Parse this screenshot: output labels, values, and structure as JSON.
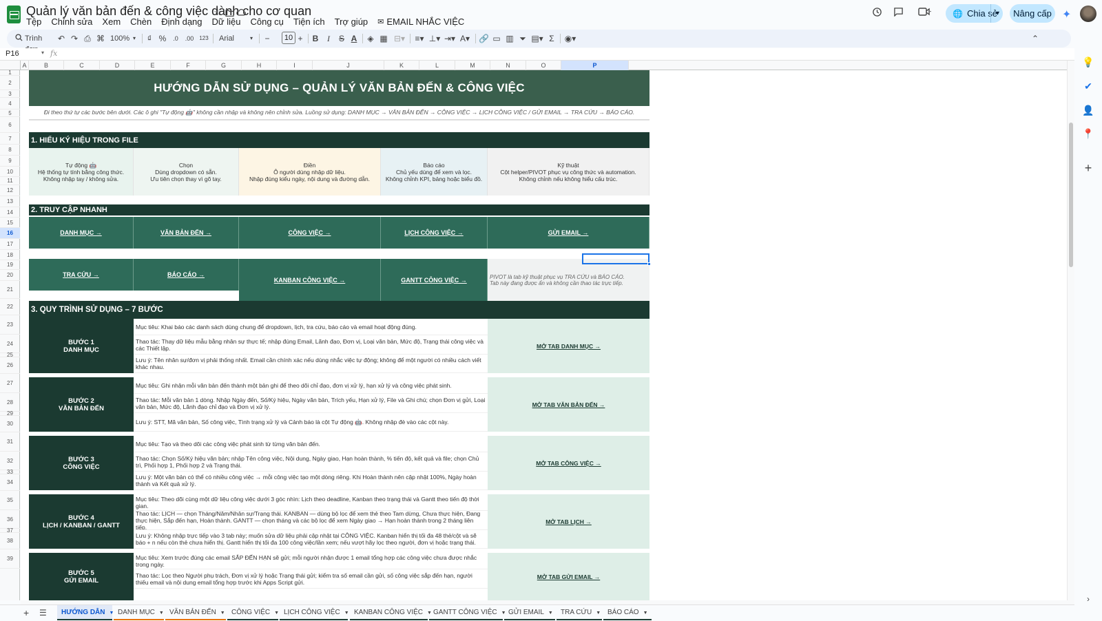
{
  "app": {
    "title": "Quản lý văn bản đến & công việc dành cho cơ quan",
    "menu": [
      "Tệp",
      "Chỉnh sửa",
      "Xem",
      "Chèn",
      "Định dạng",
      "Dữ liệu",
      "Công cụ",
      "Tiện ích",
      "Trợ giúp"
    ],
    "menu_email": "EMAIL NHẮC VIỆC",
    "share": "Chia sẻ",
    "upgrade": "Nâng cấp"
  },
  "toolbar": {
    "search": "Trình đơn",
    "zoom": "100%",
    "currency": "₫",
    "percent": "%",
    "dec_down": ".0",
    "dec_up": ".00",
    "num_fmt": "123",
    "font": "Arial",
    "font_size": "10"
  },
  "formula": {
    "cell": "P16",
    "fx": "fx"
  },
  "columns": [
    "A",
    "B",
    "C",
    "D",
    "E",
    "F",
    "G",
    "H",
    "I",
    "J",
    "K",
    "L",
    "M",
    "N",
    "O",
    "P"
  ],
  "rows": [
    "1",
    "2",
    "3",
    "4",
    "5",
    "6",
    "7",
    "8",
    "9",
    "10",
    "11",
    "12",
    "13",
    "14",
    "15",
    "16",
    "17",
    "18",
    "19",
    "20",
    "21",
    "22",
    "23",
    "24",
    "25",
    "26",
    "27",
    "28",
    "29",
    "30",
    "31",
    "32",
    "33",
    "34",
    "35",
    "36",
    "37",
    "38",
    "39"
  ],
  "sheet": {
    "banner": "HƯỚNG DẪN SỬ DỤNG – QUẢN LÝ VĂN BẢN ĐẾN & CÔNG VIỆC",
    "subline": "Đi theo thứ tự các bước bên dưới. Các ô ghi \"Tự động 🤖\" không cần nhập và không nên chỉnh sửa. Luồng sử dụng: DANH MỤC → VĂN BẢN ĐẾN → CÔNG VIỆC → LỊCH CÔNG VIỆC / GỬI EMAIL → TRA CỨU → BÁO CÁO.",
    "sec1": "1. HIỂU KÝ HIỆU TRONG FILE",
    "legend": [
      {
        "title": "Tự động 🤖",
        "l1": "Hệ thống tự tính bằng công thức.",
        "l2": "Không nhập tay / không sửa.",
        "bg": "#e8f3ee"
      },
      {
        "title": "Chọn",
        "l1": "Dùng dropdown có sẵn.",
        "l2": "Ưu tiên chọn thay vì gõ tay.",
        "bg": "#eef5f1"
      },
      {
        "title": "Điền",
        "l1": "Ô người dùng nhập dữ liệu.",
        "l2": "Nhập đúng kiểu ngày, nội dung và đường dẫn.",
        "bg": "#fdf5e4"
      },
      {
        "title": "Báo cáo",
        "l1": "Chủ yếu dùng để xem và lọc.",
        "l2": "Không chỉnh KPI, bảng hoặc biểu đồ.",
        "bg": "#e7f1f4"
      },
      {
        "title": "Kỹ thuật",
        "l1": "Cột helper/PIVOT phục vụ công thức và automation.",
        "l2": "Không chỉnh nếu không hiểu cấu trúc.",
        "bg": "#f1f1f1"
      }
    ],
    "sec2": "2. TRUY CẬP NHANH",
    "quick1": [
      "DANH MỤC →",
      "VĂN BẢN ĐẾN →",
      "CÔNG VIỆC →",
      "LỊCH CÔNG VIỆC →",
      "GỬI EMAIL →"
    ],
    "quick2": [
      "TRA CỨU →",
      "BÁO CÁO →",
      "KANBAN CÔNG VIỆC →",
      "GANTT CÔNG VIỆC →"
    ],
    "pivot_note1": "PIVOT là tab kỹ thuật phục vụ TRA CỨU và BÁO CÁO.",
    "pivot_note2": "Tab này đang được ẩn và không cần thao tác trực tiếp.",
    "sec3": "3. QUY TRÌNH SỬ DỤNG – 7 BƯỚC",
    "steps": [
      {
        "n": "BƯỚC 1",
        "name": "DANH MỤC",
        "goal": "Mục tiêu: Khai báo các danh sách dùng chung để dropdown, lịch, tra cứu, báo cáo và email hoạt động đúng.",
        "action": "Thao tác: Thay dữ liệu mẫu bằng nhân sự thực tế; nhập đúng Email, Lãnh đạo, Đơn vị, Loại văn bản, Mức độ, Trạng thái công việc và các Thiết lập.",
        "note": "Lưu ý: Tên nhân sự/đơn vị phải thống nhất. Email cần chính xác nếu dùng nhắc việc tự động; không để một người có nhiều cách viết khác nhau.",
        "link": "MỞ TAB DANH MỤC →"
      },
      {
        "n": "BƯỚC 2",
        "name": "VĂN BẢN ĐẾN",
        "goal": "Mục tiêu: Ghi nhận mỗi văn bản đến thành một bản ghi để theo dõi chỉ đạo, đơn vị xử lý, hạn xử lý và công việc phát sinh.",
        "action": "Thao tác: Mỗi văn bản 1 dòng. Nhập Ngày đến, Số/Ký hiệu, Ngày văn bản, Trích yếu, Hạn xử lý, File và Ghi chú; chọn Đơn vị gửi, Loại văn bản, Mức độ, Lãnh đạo chỉ đạo và Đơn vị xử lý.",
        "note": "Lưu ý: STT, Mã văn bản, Số công việc, Tình trạng xử lý và Cảnh báo là cột Tự động 🤖. Không nhập đè vào các cột này.",
        "link": "MỞ TAB VĂN BẢN ĐẾN →"
      },
      {
        "n": "BƯỚC 3",
        "name": "CÔNG VIỆC",
        "goal": "Mục tiêu: Tạo và theo dõi các công việc phát sinh từ từng văn bản đến.",
        "action": "Thao tác: Chọn Số/Ký hiệu văn bản; nhập Tên công việc, Nội dung, Ngày giao, Hạn hoàn thành, % tiến độ, kết quả và file; chọn Chủ trì, Phối hợp 1, Phối hợp 2 và Trạng thái.",
        "note": "Lưu ý: Một văn bản có thể có nhiều công việc → mỗi công việc tạo một dòng riêng. Khi Hoàn thành nên cập nhật 100%, Ngày hoàn thành và Kết quả xử lý.",
        "link": "MỞ TAB CÔNG VIỆC →"
      },
      {
        "n": "BƯỚC 4",
        "name": "LỊCH / KANBAN / GANTT",
        "goal": "Mục tiêu: Theo dõi cùng một dữ liệu công việc dưới 3 góc nhìn: Lịch theo deadline, Kanban theo trạng thái và Gantt theo tiến độ thời gian.",
        "action": "Thao tác: LỊCH — chọn Tháng/Năm/Nhân sự/Trạng thái. KANBAN — dùng bộ lọc để xem thẻ theo Tam dừng, Chưa thực hiện, Đang thực hiện, Sắp đến hạn, Hoàn thành. GANTT — chọn tháng và các bộ lọc để xem Ngày giao → Hạn hoàn thành trong 2 tháng liên tiếp.",
        "note": "Lưu ý: Không nhập trực tiếp vào 3 tab này; muốn sửa dữ liệu phải cập nhật tại CÔNG VIỆC. Kanban hiển thị tối đa 48 thẻ/cột và sẽ báo + n nếu còn thẻ chưa hiển thị. Gantt hiển thị tối đa 100 công việc/lần xem; nếu vượt hãy lọc theo người, đơn vị hoặc trạng thái.",
        "link": "MỞ TAB LỊCH →"
      },
      {
        "n": "BƯỚC 5",
        "name": "GỬI EMAIL",
        "goal": "Mục tiêu: Xem trước đúng các email SẮP ĐẾN HẠN sẽ gửi; mỗi người nhận được 1 email tổng hợp các công việc chưa được nhắc trong ngày.",
        "action": "Thao tác: Lọc theo Người phụ trách, Đơn vị xử lý hoặc Trạng thái gửi; kiểm tra số email cần gửi, số công việc sắp đến hạn, người thiếu email và nội dung email tổng hợp trước khi Apps Script gửi.",
        "note": "",
        "link": "MỞ TAB GỬI EMAIL →"
      }
    ]
  },
  "tabs": [
    {
      "label": "HƯỚNG DẪN",
      "color": "#1b3a31"
    },
    {
      "label": "DANH MỤC",
      "color": "#e8710a"
    },
    {
      "label": "VĂN BẢN ĐẾN",
      "color": "#e8710a"
    },
    {
      "label": "CÔNG VIỆC",
      "color": "#1b3a31"
    },
    {
      "label": "LỊCH CÔNG VIỆC",
      "color": "#1b3a31"
    },
    {
      "label": "KANBAN CÔNG VIỆC",
      "color": "#1b3a31"
    },
    {
      "label": "GANTT CÔNG VIỆC",
      "color": "#1b3a31"
    },
    {
      "label": "GỬI EMAIL",
      "color": "#1b3a31"
    },
    {
      "label": "TRA CỨU",
      "color": "#1b3a31"
    },
    {
      "label": "BÁO CÁO",
      "color": "#1b3a31"
    }
  ]
}
